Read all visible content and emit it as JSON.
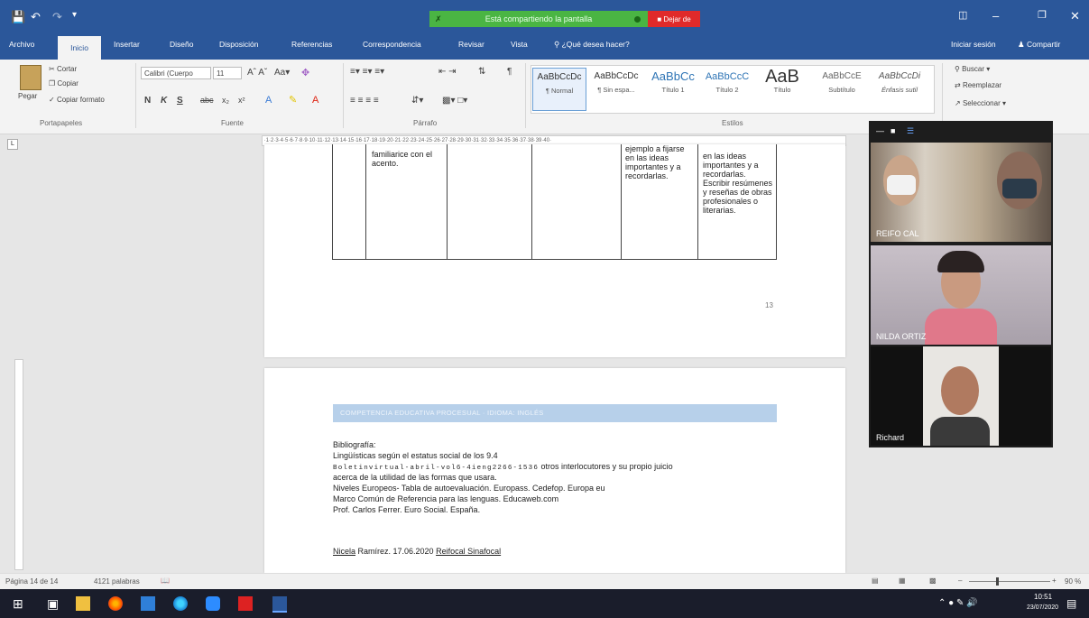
{
  "titlebar": {
    "share_notice": "Está compartiendo la pantalla",
    "stop_share": "Dejar de"
  },
  "tabs": [
    "Archivo",
    "Inicio",
    "Insertar",
    "Diseño",
    "Disposición",
    "Referencias",
    "Correspondencia",
    "Revisar",
    "Vista"
  ],
  "tell_me": "¿Qué desea hacer?",
  "account": {
    "signin": "Iniciar sesión",
    "share": "Compartir"
  },
  "ribbon": {
    "clipboard": {
      "paste": "Pegar",
      "cut": "Cortar",
      "copy": "Copiar",
      "format_painter": "Copiar formato",
      "group": "Portapapeles"
    },
    "font": {
      "name": "Calibri (Cuerpo",
      "size": "11",
      "group": "Fuente"
    },
    "paragraph": {
      "group": "Párrafo"
    },
    "styles": {
      "group": "Estilos",
      "items": [
        {
          "preview": "AaBbCcDc",
          "name": "¶ Normal"
        },
        {
          "preview": "AaBbCcDc",
          "name": "¶ Sin espa..."
        },
        {
          "preview": "AaBbCc",
          "name": "Título 1"
        },
        {
          "preview": "AaBbCcC",
          "name": "Título 2"
        },
        {
          "preview": "AaB",
          "name": "Título"
        },
        {
          "preview": "AaBbCcE",
          "name": "Subtítulo"
        },
        {
          "preview": "AaBbCcDi",
          "name": "Énfasis sutil"
        }
      ]
    },
    "editing": {
      "find": "Buscar",
      "replace": "Reemplazar",
      "select": "Seleccionar"
    }
  },
  "doc": {
    "table_cells": {
      "col1": "familiarice con el acento.",
      "col4": "ejemplo a fijarse en las ideas importantes y a recordarlas.",
      "col5": "en las ideas importantes y a recordarlas. Escribir resúmenes y reseñas de obras profesionales o literarias."
    },
    "page_number": "13",
    "header_bar": "COMPETENCIA EDUCATIVA PROCESUAL · IDIOMA: INGLÉS",
    "bibliography": [
      "Bibliografía:",
      "Lingüísticas según el estatus social de los 9.4",
      "acerca de la utilidad de las formas que usara.",
      "Niveles Europeos- Tabla de autoevaluación. Europass. Cedefop. Europa eu",
      "Marco Común de Referencia para las lenguas. Educaweb.com",
      "Prof. Carlos Ferrer. Euro Social. España."
    ],
    "boletin_spaced": "Boletinvirtual-abril-vol6-4ieng2266-1536",
    "boletin_rest": " otros interlocutores y su propio juicio",
    "signature": {
      "name": "Nicela",
      "rest": " Ramírez. 17.06.2020 ",
      "org": "Reifocal Sinafocal"
    }
  },
  "status": {
    "page": "Página 14 de 14",
    "words": "4121 palabras",
    "zoom": "90 %"
  },
  "participants": [
    {
      "name": "REIFO CAL"
    },
    {
      "name": "NILDA ORTIZ"
    },
    {
      "name": "Richard"
    }
  ],
  "clock": {
    "time": "10:51",
    "date": "23/07/2020"
  },
  "colors": {
    "word_blue": "#2b579a",
    "share_green": "#4ab543",
    "stop_red": "#e02a2a",
    "header_band": "#b7d0ea"
  }
}
